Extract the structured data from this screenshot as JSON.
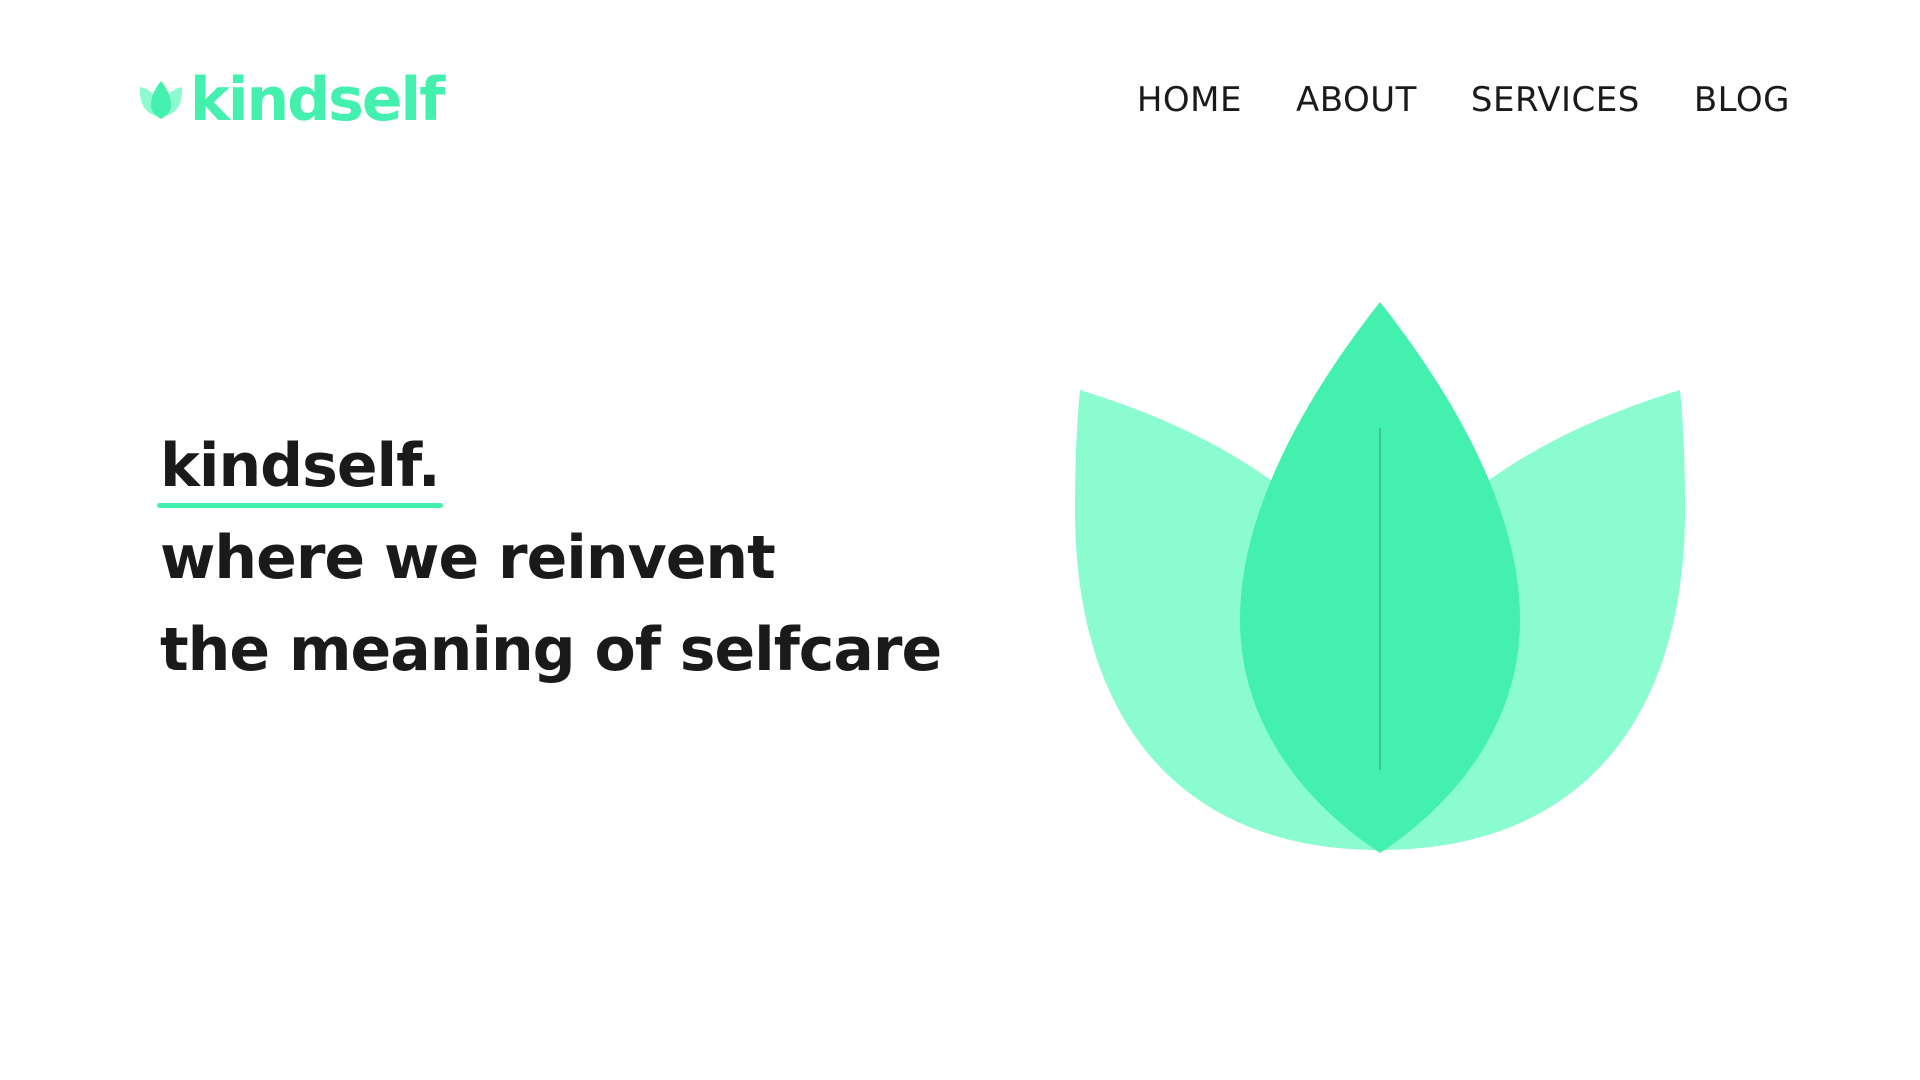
{
  "brand": {
    "name": "kindself",
    "logo_icon": "lotus-icon"
  },
  "nav": {
    "items": [
      {
        "label": "HOME"
      },
      {
        "label": "ABOUT"
      },
      {
        "label": "SERVICES"
      },
      {
        "label": "BLOG"
      }
    ]
  },
  "hero": {
    "brand_line": "kindself.",
    "line2": "where we reinvent",
    "line3": "the meaning of selfcare",
    "illustration": "lotus-icon"
  },
  "colors": {
    "accent": "#44f0ad",
    "accent_light": "#8bfccf",
    "text": "#1a1a1a",
    "background": "#ffffff"
  }
}
